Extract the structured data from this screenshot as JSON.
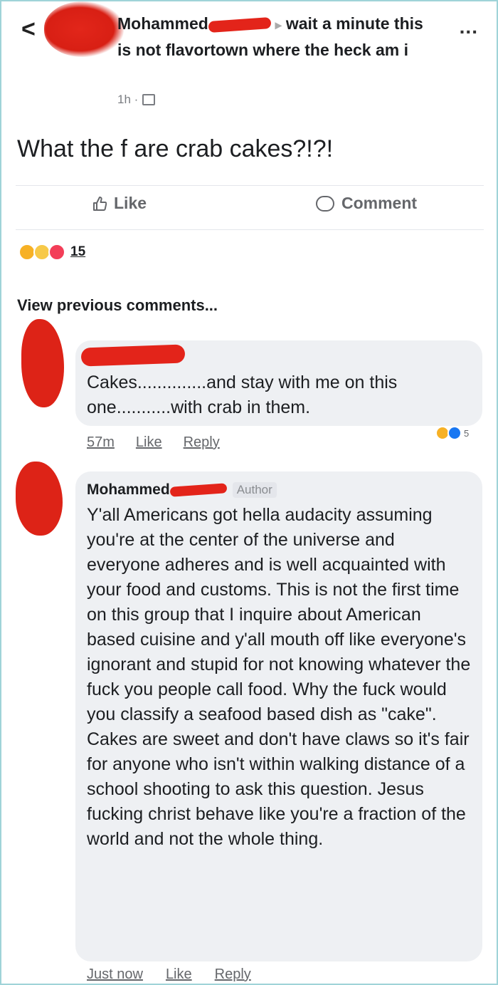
{
  "header": {
    "back_glyph": "<",
    "more_glyph": "...",
    "author_first": "Mohammed",
    "arrow": "▸",
    "group_text": "wait a minute this is not flavortown where the heck am i",
    "time": "1h ·",
    "privacy_icon": "globe-icon"
  },
  "post": {
    "text": "What the f are crab cakes?!?!"
  },
  "actions": {
    "like_label": "Like",
    "comment_label": "Comment"
  },
  "reactions": {
    "count": "15",
    "types": [
      "haha",
      "wow",
      "love"
    ]
  },
  "comments_section": {
    "view_previous": "View previous comments..."
  },
  "comments": [
    {
      "text": "Cakes..............and stay with me on this one...........with crab in them.",
      "time": "57m",
      "like_label": "Like",
      "reply_label": "Reply",
      "reaction_count": "5"
    },
    {
      "name": "Mohammed",
      "badge": "Author",
      "text": "Y'all Americans got hella audacity assuming you're at the center of the universe and everyone adheres and is well acquainted with your food and customs. This is not the first time on this group that I inquire about American based cuisine and y'all mouth off like everyone's ignorant and stupid for not knowing whatever the fuck you people call food. Why the fuck would you classify a seafood based dish as \"cake\". Cakes are sweet and don't have claws so it's fair for anyone who isn't within walking distance of a school shooting to ask this question. Jesus fucking christ behave like you're a fraction of the world and not the whole thing.",
      "time": "Just now",
      "like_label": "Like",
      "reply_label": "Reply"
    }
  ],
  "colors": {
    "redaction": "#e3241a",
    "bubble": "#eef0f3",
    "muted_text": "#65676b"
  }
}
